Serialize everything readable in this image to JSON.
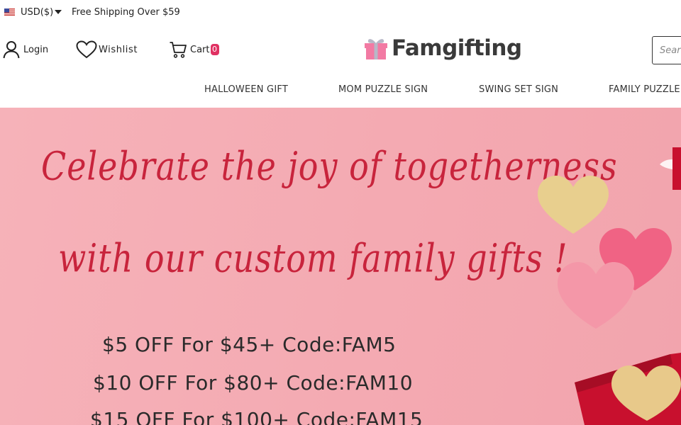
{
  "topbar": {
    "currency": "USD($)",
    "flag_icon": "us-flag-icon",
    "shipping_text": "Free Shipping Over $59"
  },
  "header": {
    "login_label": "Login",
    "wishlist_label": "Wishlist",
    "cart_label": "Cart",
    "cart_count": "0",
    "logo_text": "Famgifting",
    "search_placeholder": "Search"
  },
  "nav": {
    "items": [
      {
        "label": "HALLOWEEN GIFT"
      },
      {
        "label": "MOM PUZZLE SIGN"
      },
      {
        "label": "SWING SET SIGN"
      },
      {
        "label": "FAMILY PUZZLE"
      }
    ]
  },
  "banner": {
    "headline_line1": "Celebrate the joy of togetherness",
    "headline_line2": "with our custom family gifts !",
    "offers": [
      "$5 OFF  For $45+ Code:FAM5",
      "$10 OFF  For $80+ Code:FAM10",
      "$15 OFF  For $100+ Code:FAM15"
    ]
  },
  "colors": {
    "banner_bg": "#f4aab2",
    "headline": "#c8243c",
    "cart_badge": "#e03162",
    "logo_gift": "#f27aa3"
  }
}
